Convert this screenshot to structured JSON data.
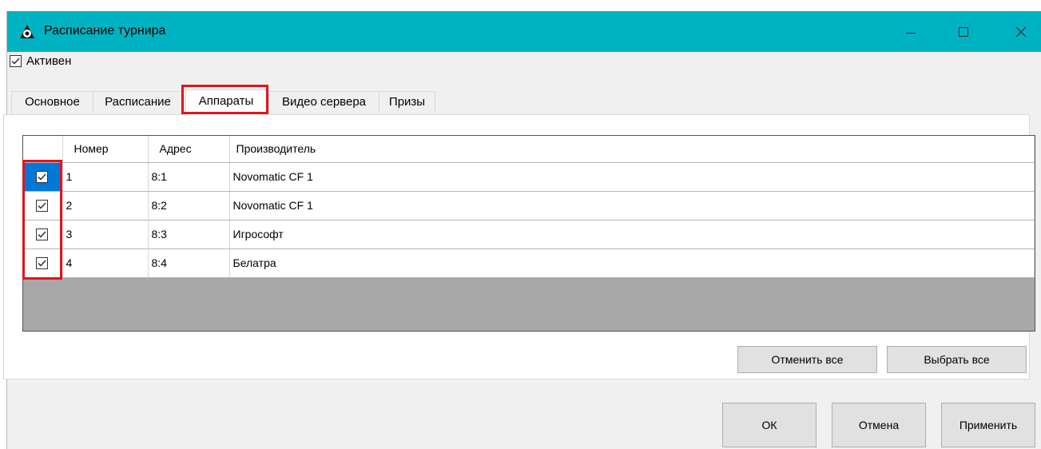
{
  "window": {
    "title": "Расписание турнира",
    "icon": "poker-chip-icon"
  },
  "active": {
    "label": "Активен",
    "checked": true
  },
  "tabs": [
    {
      "label": "Основное"
    },
    {
      "label": "Расписание"
    },
    {
      "label": "Аппараты",
      "selected": true
    },
    {
      "label": "Видео сервера"
    },
    {
      "label": "Призы"
    }
  ],
  "grid": {
    "columns": [
      "",
      "Номер",
      "Адрес",
      "Производитель"
    ],
    "rows": [
      {
        "checked": true,
        "number": "1",
        "address": "8:1",
        "maker": "Novomatic CF 1"
      },
      {
        "checked": true,
        "number": "2",
        "address": "8:2",
        "maker": "Novomatic CF 1"
      },
      {
        "checked": true,
        "number": "3",
        "address": "8:3",
        "maker": "Игрософт"
      },
      {
        "checked": true,
        "number": "4",
        "address": "8:4",
        "maker": "Белатра"
      }
    ]
  },
  "actions": {
    "deselect_all": "Отменить все",
    "select_all": "Выбрать все"
  },
  "dialog_buttons": {
    "ok": "ОК",
    "cancel": "Отмена",
    "apply": "Применить"
  },
  "colors": {
    "titlebar": "#00b3c3",
    "highlight": "#e1141e",
    "selection": "#0078d7"
  }
}
